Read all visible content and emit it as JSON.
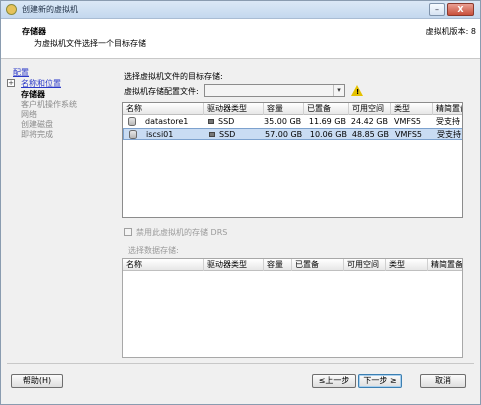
{
  "window": {
    "title": "创建新的虚拟机",
    "min_glyph": "–",
    "close_glyph": "X"
  },
  "header": {
    "title": "存储器",
    "subtitle": "为虚拟机文件选择一个目标存储",
    "version": "虚拟机版本: 8"
  },
  "nav": {
    "items": [
      {
        "label": "配置",
        "state": "link"
      },
      {
        "label": "名称和位置",
        "state": "link"
      },
      {
        "label": "存储器",
        "state": "current"
      },
      {
        "label": "客户机操作系统",
        "state": "disabled"
      },
      {
        "label": "网络",
        "state": "disabled"
      },
      {
        "label": "创建磁盘",
        "state": "disabled"
      },
      {
        "label": "即将完成",
        "state": "disabled"
      }
    ],
    "expand_glyph": "+"
  },
  "content": {
    "select_target_label": "选择虚拟机文件的目标存储:",
    "profile_label": "虚拟机存储配置文件:",
    "profile_value": "",
    "profile_arrow": "▾",
    "warning_glyph": "!",
    "table_headers": [
      "名称",
      "驱动器类型",
      "容量",
      "已置备",
      "可用空间",
      "类型",
      "精简置备"
    ],
    "datastores": [
      {
        "name": "datastore1",
        "drive_type": "SSD",
        "capacity": "35.00 GB",
        "provisioned": "11.69 GB",
        "free": "24.42 GB",
        "type": "VMFS5",
        "thin": "受支持"
      },
      {
        "name": "iscsi01",
        "drive_type": "SSD",
        "capacity": "57.00 GB",
        "provisioned": "10.06 GB",
        "free": "48.85 GB",
        "type": "VMFS5",
        "thin": "受支持"
      }
    ],
    "selected_index": 1,
    "drs_checkbox_label": "禁用此虚拟机的存储 DRS",
    "select_datastore_label": "选择数据存储:",
    "lower_table_headers": [
      "名称",
      "驱动器类型",
      "容量",
      "已置备",
      "可用空间",
      "类型",
      "精简置备"
    ]
  },
  "footer": {
    "help": "帮助(H)",
    "back": "≤上一步",
    "next": "下一步 ≥",
    "cancel": "取消"
  }
}
